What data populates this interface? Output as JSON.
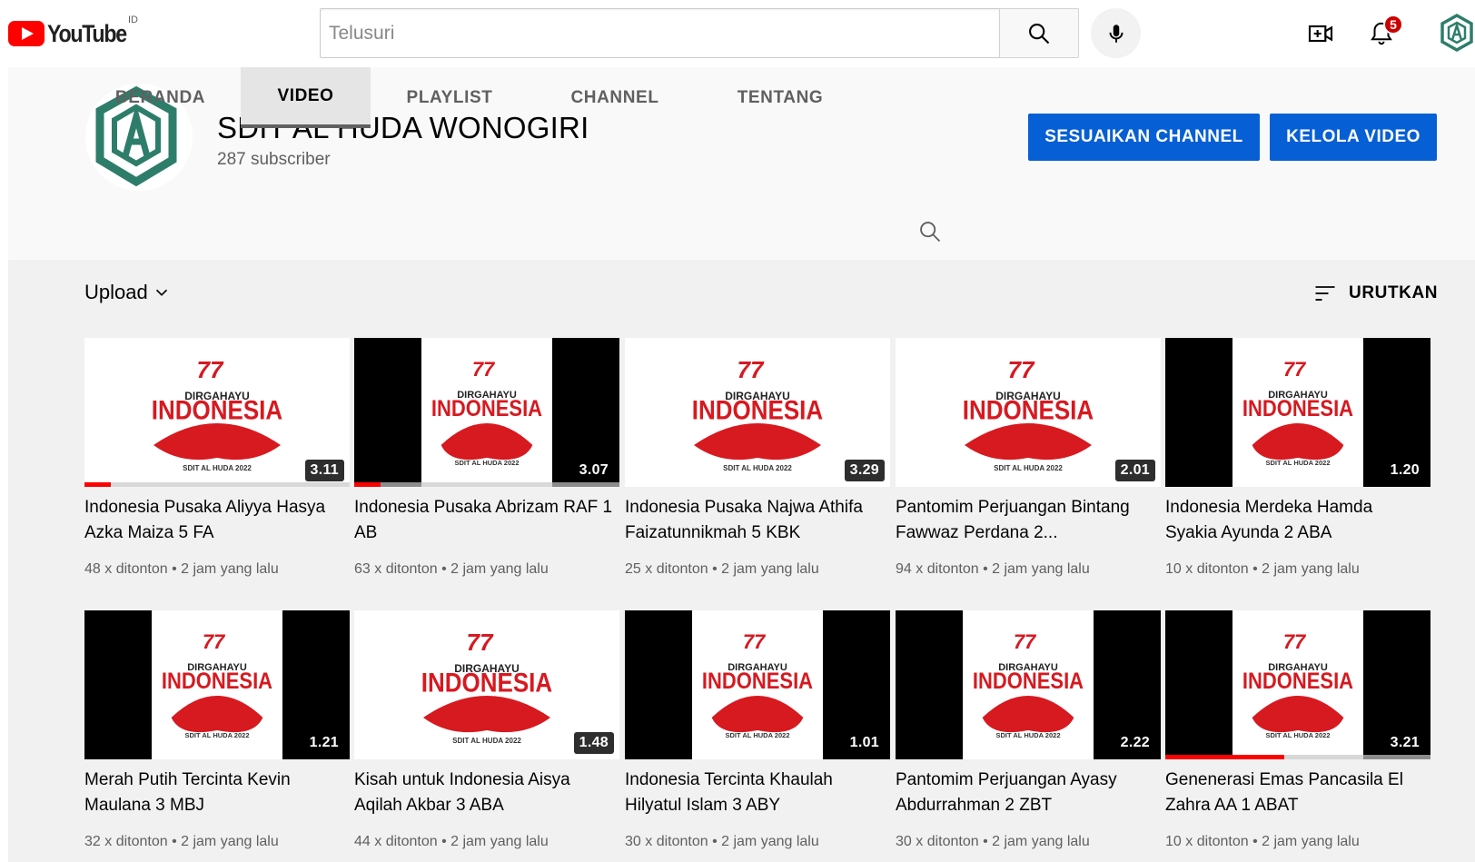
{
  "header": {
    "logo_text": "YouTube",
    "region": "ID",
    "search_placeholder": "Telusuri",
    "notification_count": "5",
    "icons": [
      "search-icon",
      "mic-icon",
      "create-video-icon",
      "bell-icon",
      "account-avatar"
    ]
  },
  "channel": {
    "name": "SDIT AL HUDA WONOGIRI",
    "subscribers": "287 subscriber",
    "customize_label": "SESUAIKAN CHANNEL",
    "manage_label": "KELOLA VIDEO",
    "accent_color": "#065fd4",
    "logo_color": "#2e7d6b",
    "tabs": [
      "BERANDA",
      "VIDEO",
      "PLAYLIST",
      "CHANNEL",
      "TENTANG"
    ],
    "active_tab": "VIDEO"
  },
  "filters": {
    "upload_label": "Upload",
    "sort_label": "URUTKAN"
  },
  "videos": [
    {
      "title": "Indonesia Pusaka Aliyya Hasya Azka Maiza 5 FA",
      "views": "48 x ditonton",
      "age": "2 jam yang lalu",
      "duration": "3.11",
      "format": "wide",
      "watched": 0.1
    },
    {
      "title": "Indonesia Pusaka Abrizam RAF 1 AB",
      "views": "63 x ditonton",
      "age": "2 jam yang lalu",
      "duration": "3.07",
      "format": "portrait",
      "watched": 0.1
    },
    {
      "title": "Indonesia Pusaka Najwa Athifa Faizatunnikmah 5 KBK",
      "views": "25 x ditonton",
      "age": "2 jam yang lalu",
      "duration": "3.29",
      "format": "wide",
      "watched": 0
    },
    {
      "title": "Pantomim Perjuangan Bintang Fawwaz Perdana 2...",
      "views": "94 x ditonton",
      "age": "2 jam yang lalu",
      "duration": "2.01",
      "format": "wide",
      "watched": 0
    },
    {
      "title": "Indonesia Merdeka Hamda Syakia Ayunda 2 ABA",
      "views": "10 x ditonton",
      "age": "2 jam yang lalu",
      "duration": "1.20",
      "format": "portrait",
      "watched": 0
    },
    {
      "title": "Merah Putih Tercinta Kevin Maulana 3 MBJ",
      "views": "32 x ditonton",
      "age": "2 jam yang lalu",
      "duration": "1.21",
      "format": "portrait",
      "watched": 0
    },
    {
      "title": "Kisah untuk Indonesia Aisya Aqilah Akbar 3 ABA",
      "views": "44 x ditonton",
      "age": "2 jam yang lalu",
      "duration": "1.48",
      "format": "wide",
      "watched": 0
    },
    {
      "title": "Indonesia Tercinta Khaulah Hilyatul Islam 3 ABY",
      "views": "30 x ditonton",
      "age": "2 jam yang lalu",
      "duration": "1.01",
      "format": "portrait",
      "watched": 0
    },
    {
      "title": "Pantomim Perjuangan Ayasy Abdurrahman 2 ZBT",
      "views": "30 x ditonton",
      "age": "2 jam yang lalu",
      "duration": "2.22",
      "format": "portrait",
      "watched": 0
    },
    {
      "title": "Genenerasi Emas Pancasila El Zahra AA 1 ABAT",
      "views": "10 x ditonton",
      "age": "2 jam yang lalu",
      "duration": "3.21",
      "format": "portrait",
      "watched": 0.45
    }
  ],
  "thumbnail_text": {
    "line1": "DIRGAHAYU",
    "line2": "INDONESIA",
    "footer": "SDIT AL HUDA 2022",
    "anniversary": "77",
    "red": "#d71920"
  }
}
